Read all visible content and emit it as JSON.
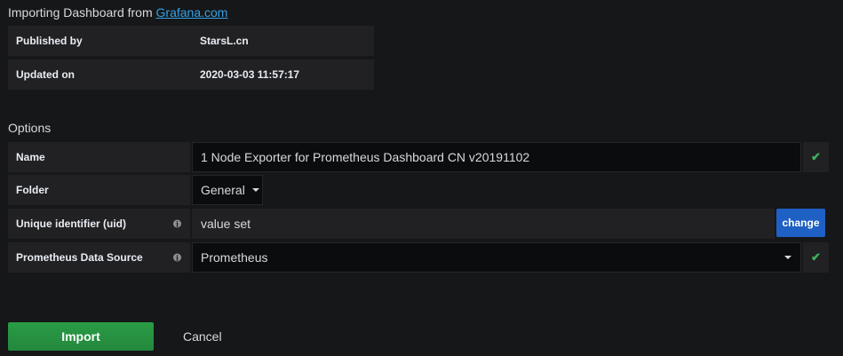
{
  "header": {
    "prefix": "Importing Dashboard from ",
    "link": "Grafana.com"
  },
  "info": [
    {
      "label": "Published by",
      "value": "StarsL.cn"
    },
    {
      "label": "Updated on",
      "value": "2020-03-03 11:57:17"
    }
  ],
  "options": {
    "title": "Options",
    "name_label": "Name",
    "name_value": "1  Node Exporter for Prometheus Dashboard CN v20191102",
    "folder_label": "Folder",
    "folder_value": "General",
    "uid_label": "Unique identifier (uid)",
    "uid_value": "value set",
    "uid_change": "change",
    "ds_label": "Prometheus Data Source",
    "ds_value": "Prometheus",
    "info_glyph": "i"
  },
  "actions": {
    "import": "Import",
    "cancel": "Cancel"
  },
  "colors": {
    "link": "#33a2e5",
    "check": "#3eb15b",
    "change_button": "#1f60c4",
    "import_button": "#299c46"
  }
}
